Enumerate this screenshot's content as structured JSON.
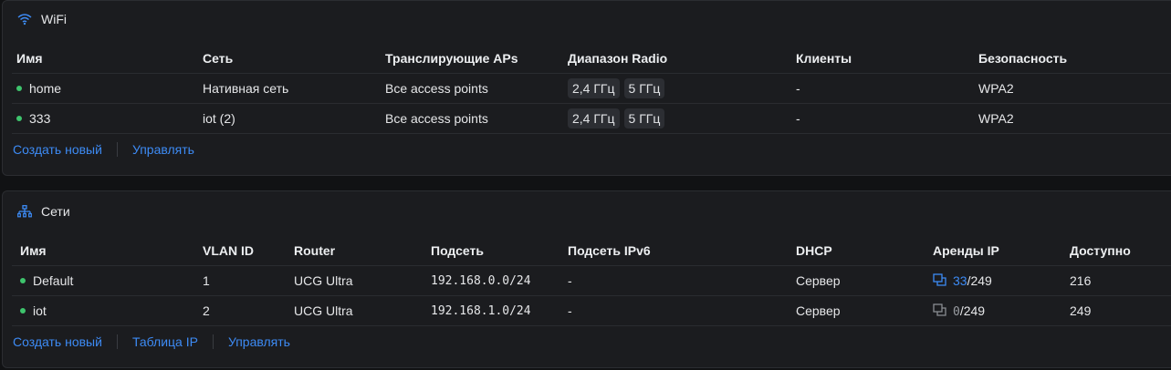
{
  "wifi": {
    "title": "WiFi",
    "columns": [
      "Имя",
      "Сеть",
      "Транслирующие APs",
      "Диапазон Radio",
      "Клиенты",
      "Безопасность"
    ],
    "rows": [
      {
        "name": "home",
        "network": "Нативная сеть",
        "aps": "Все access points",
        "band1": "2,4 ГГц",
        "band2": "5 ГГц",
        "clients": "-",
        "security": "WPA2"
      },
      {
        "name": "333",
        "network": "iot (2)",
        "aps": "Все access points",
        "band1": "2,4 ГГц",
        "band2": "5 ГГц",
        "clients": "-",
        "security": "WPA2"
      }
    ],
    "links": {
      "create": "Создать новый",
      "manage": "Управлять"
    }
  },
  "networks": {
    "title": "Сети",
    "columns": [
      "Имя",
      "VLAN ID",
      "Router",
      "Подсеть",
      "Подсеть IPv6",
      "DHCP",
      "Аренды IP",
      "Доступно"
    ],
    "rows": [
      {
        "name": "Default",
        "vlan": "1",
        "router": "UCG Ultra",
        "subnet": "192.168.0.0/24",
        "ipv6": "-",
        "dhcp": "Сервер",
        "leases_used": "33",
        "leases_sep": "/",
        "leases_total": "249",
        "available": "216"
      },
      {
        "name": "iot",
        "vlan": "2",
        "router": "UCG Ultra",
        "subnet": "192.168.1.0/24",
        "ipv6": "-",
        "dhcp": "Сервер",
        "leases_used": "0",
        "leases_sep": "/",
        "leases_total": "249",
        "available": "249"
      }
    ],
    "links": {
      "create": "Создать новый",
      "ip_table": "Таблица IP",
      "manage": "Управлять"
    }
  },
  "colors": {
    "accent": "#3d8bf5",
    "status_online": "#3ec46d"
  },
  "icons": {
    "wifi": "wifi-icon",
    "networks": "network-topology-icon",
    "lease": "lease-icon"
  }
}
